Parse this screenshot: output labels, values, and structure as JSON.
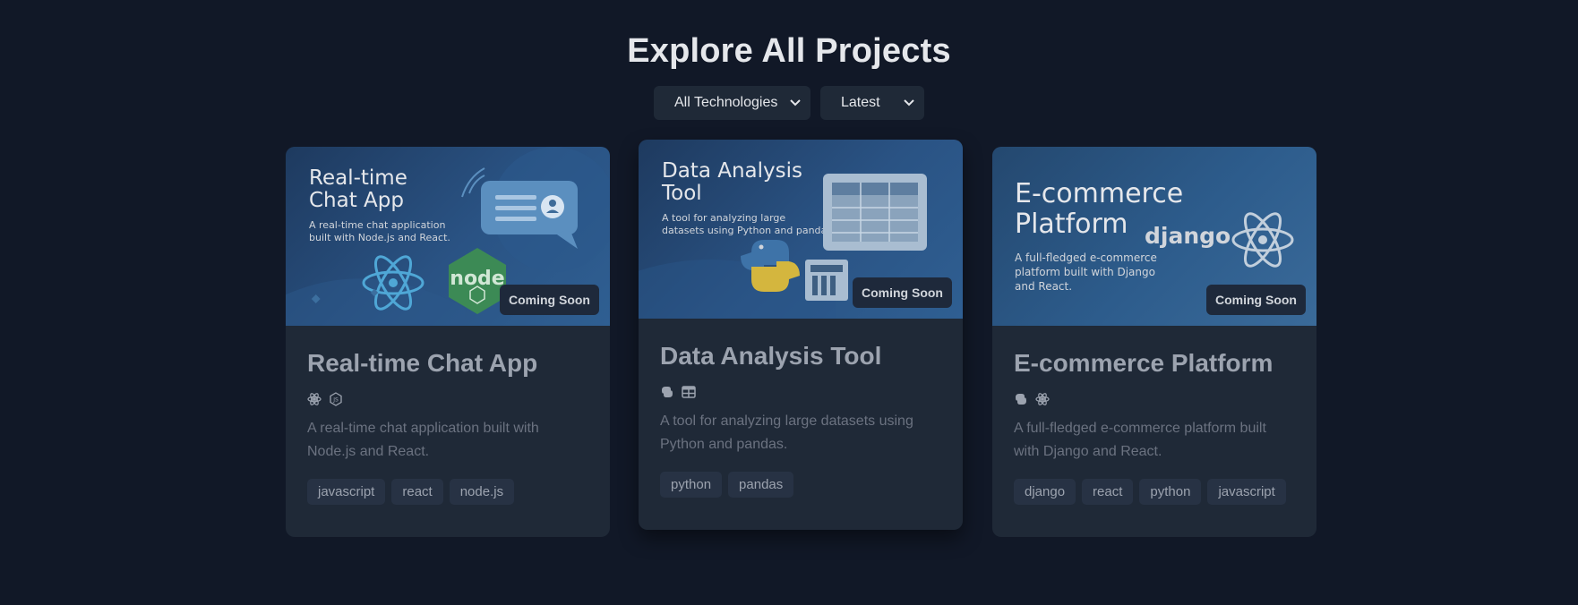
{
  "header": {
    "title": "Explore All Projects"
  },
  "filters": {
    "technology": {
      "selected": "All Technologies"
    },
    "sort": {
      "selected": "Latest"
    }
  },
  "projects": [
    {
      "title": "Real-time Chat App",
      "description": "A real-time chat application built with Node.js and React.",
      "badge": "Coming Soon",
      "tags": [
        "javascript",
        "react",
        "node.js"
      ],
      "tech_icons": [
        "react-icon",
        "nodejs-icon"
      ],
      "thumb": {
        "title_line1": "Real-time",
        "title_line2": "Chat App",
        "sub_line1": "A real-time chat application",
        "sub_line2": "built with Node.js and React.",
        "logo_text": "node"
      }
    },
    {
      "title": "Data Analysis Tool",
      "description": "A tool for analyzing large datasets using Python and pandas.",
      "badge": "Coming Soon",
      "tags": [
        "python",
        "pandas"
      ],
      "tech_icons": [
        "python-icon",
        "table-icon"
      ],
      "thumb": {
        "title_line1": "Data Analysis",
        "title_line2": "Tool",
        "sub_line1": "A tool for analyzing large",
        "sub_line2": "datasets using Python and pandas"
      }
    },
    {
      "title": "E-commerce Platform",
      "description": "A full-fledged e-commerce platform built with Django and React.",
      "badge": "Coming Soon",
      "tags": [
        "django",
        "react",
        "python",
        "javascript"
      ],
      "tech_icons": [
        "python-icon",
        "react-icon"
      ],
      "thumb": {
        "title_line1": "E-commerce",
        "title_line2": "Platform",
        "sub_line1": "A full-fledged e-commerce",
        "sub_line2": "platform built with Django",
        "sub_line3": "and React.",
        "logo_text": "django"
      }
    }
  ]
}
